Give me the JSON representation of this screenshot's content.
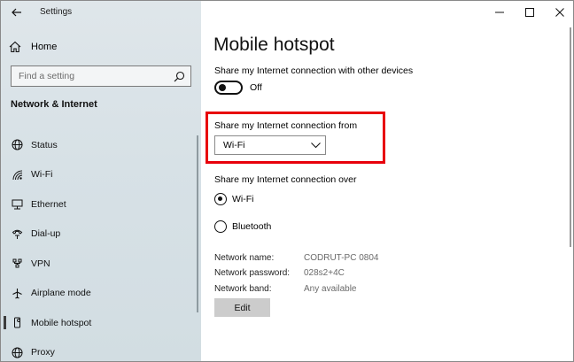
{
  "window": {
    "app_title": "Settings"
  },
  "sidebar": {
    "home_label": "Home",
    "search_placeholder": "Find a setting",
    "section_title": "Network & Internet",
    "items": [
      {
        "label": "Status",
        "icon": "globe-icon"
      },
      {
        "label": "Wi-Fi",
        "icon": "wifi-icon"
      },
      {
        "label": "Ethernet",
        "icon": "ethernet-icon"
      },
      {
        "label": "Dial-up",
        "icon": "phone-icon"
      },
      {
        "label": "VPN",
        "icon": "vpn-icon"
      },
      {
        "label": "Airplane mode",
        "icon": "airplane-icon"
      },
      {
        "label": "Mobile hotspot",
        "icon": "hotspot-icon",
        "active": true
      },
      {
        "label": "Proxy",
        "icon": "globe-icon"
      }
    ]
  },
  "main": {
    "title": "Mobile hotspot",
    "share_devices_label": "Share my Internet connection with other devices",
    "toggle_state": "Off",
    "share_from_label": "Share my Internet connection from",
    "share_from_value": "Wi-Fi",
    "share_over_label": "Share my Internet connection over",
    "share_over_options": [
      "Wi-Fi",
      "Bluetooth"
    ],
    "share_over_selected": "Wi-Fi",
    "network_name_label": "Network name:",
    "network_name_value": "CODRUT-PC 0804",
    "network_password_label": "Network password:",
    "network_password_value": "028s2+4C",
    "network_band_label": "Network band:",
    "network_band_value": "Any available",
    "edit_label": "Edit"
  },
  "colors": {
    "highlight": "#e8000b",
    "sidebar_bg": "#d9e2e6"
  }
}
